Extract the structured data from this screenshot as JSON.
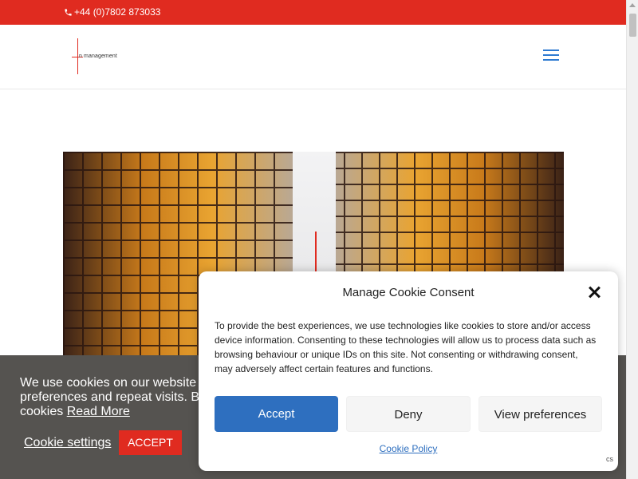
{
  "topbar": {
    "phone": "+44 (0)7802 873033"
  },
  "header": {
    "logo_text": "n management"
  },
  "cookie_bar": {
    "message_line1": "We use cookies on our website to",
    "message_line2": "preferences and repeat visits. By",
    "message_line3": "cookies",
    "read_more": "Read More",
    "settings": "Cookie settings",
    "accept": "ACCEPT"
  },
  "consent_modal": {
    "title": "Manage Cookie Consent",
    "body": "To provide the best experiences, we use technologies like cookies to store and/or access device information. Consenting to these technologies will allow us to process data such as browsing behaviour or unique IDs on this site. Not consenting or withdrawing consent, may adversely affect certain features and functions.",
    "accept": "Accept",
    "deny": "Deny",
    "preferences": "View preferences",
    "policy": "Cookie Policy"
  },
  "recaptcha_text": "cs",
  "colors": {
    "brand_red": "#e02b20",
    "accent_blue": "#2e6fbf",
    "cookie_bar_bg": "#555350"
  }
}
